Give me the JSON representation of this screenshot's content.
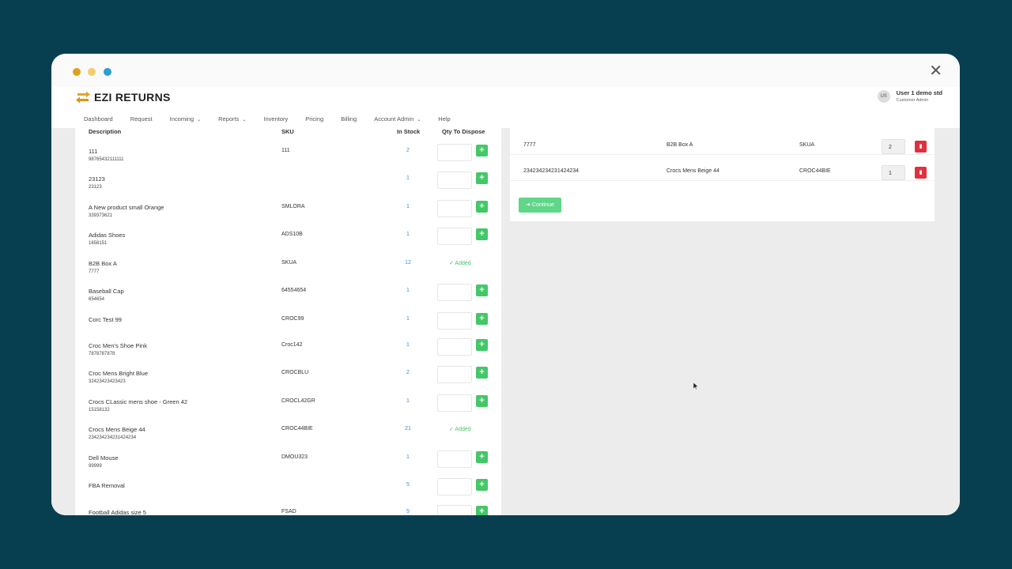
{
  "app": {
    "logo_text": "EZI RETURNS",
    "close_symbol": "✕",
    "user": {
      "initials": "US",
      "name": "User 1 demo std",
      "role": "Customer Admin"
    }
  },
  "nav": [
    {
      "label": "Dashboard",
      "dropdown": false
    },
    {
      "label": "Request",
      "dropdown": false
    },
    {
      "label": "Incoming",
      "dropdown": true
    },
    {
      "label": "Reports",
      "dropdown": true
    },
    {
      "label": "Inventory",
      "dropdown": false
    },
    {
      "label": "Pricing",
      "dropdown": false
    },
    {
      "label": "Billing",
      "dropdown": false
    },
    {
      "label": "Account Admin",
      "dropdown": true
    },
    {
      "label": "Help",
      "dropdown": false
    }
  ],
  "colors": {
    "accent_green": "#44c768",
    "delete_red": "#e0303e",
    "stock_blue": "#3a8fd9",
    "background": "#073f50"
  },
  "products_table": {
    "headers": {
      "description": "Description",
      "sku": "SKU",
      "in_stock": "In Stock",
      "qty": "Qty To Dispose"
    },
    "add_symbol": "+",
    "added_label": "✓ Added",
    "rows": [
      {
        "description": "111",
        "code": "98765432111111",
        "sku": "111",
        "stock": "2",
        "added": false
      },
      {
        "description": "23123",
        "code": "23123",
        "sku": "",
        "stock": "1",
        "added": false
      },
      {
        "description": "A New product small Orange",
        "code": "339373621",
        "sku": "SMLORA",
        "stock": "1",
        "added": false
      },
      {
        "description": "Adidas Shoes",
        "code": "1658151",
        "sku": "ADS10B",
        "stock": "1",
        "added": false
      },
      {
        "description": "B2B Box A",
        "code": "7777",
        "sku": "SKUA",
        "stock": "12",
        "added": true
      },
      {
        "description": "Baseball Cap",
        "code": "654654",
        "sku": "64554654",
        "stock": "1",
        "added": false
      },
      {
        "description": "Corc Test 99",
        "code": "",
        "sku": "CROC99",
        "stock": "1",
        "added": false
      },
      {
        "description": "Croc Men's Shoe Pink",
        "code": "7878787878",
        "sku": "Croc142",
        "stock": "1",
        "added": false
      },
      {
        "description": "Croc Mens Bright Blue",
        "code": "32423423423423",
        "sku": "CROCBLU",
        "stock": "2",
        "added": false
      },
      {
        "description": "Crocs CLassic mens shoe - Green 42",
        "code": "15158132",
        "sku": "CROCL42GR",
        "stock": "1",
        "added": false
      },
      {
        "description": "Crocs Mens Beige 44",
        "code": "234234234231424234",
        "sku": "CROC44BIE",
        "stock": "21",
        "added": true
      },
      {
        "description": "Dell Mouse",
        "code": "99999",
        "sku": "DMOU323",
        "stock": "1",
        "added": false
      },
      {
        "description": "FBA Removal",
        "code": "",
        "sku": "",
        "stock": "5",
        "added": false
      },
      {
        "description": "Football Adidas size 5",
        "code": "",
        "sku": "FSAD",
        "stock": "5",
        "added": false
      }
    ]
  },
  "selected_items": {
    "rows": [
      {
        "code": "7777",
        "description": "B2B Box A",
        "sku": "SKUA",
        "qty": "2"
      },
      {
        "code": "234234234231424234",
        "description": "Crocs Mens Beige 44",
        "sku": "CROC44BIE",
        "qty": "1"
      }
    ],
    "continue_label": "➜ Continue"
  }
}
